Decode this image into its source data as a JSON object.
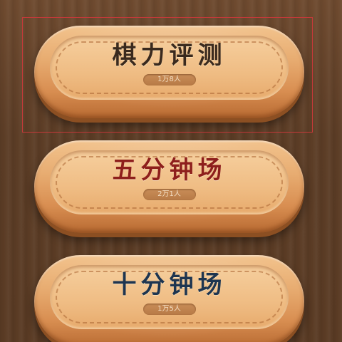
{
  "highlight": {
    "color": "#c6393a"
  },
  "modes": [
    {
      "title": "棋力评测",
      "badge": "1万8人",
      "title_color": "#3a2a1e"
    },
    {
      "title": "五分钟场",
      "badge": "2万1人",
      "title_color": "#8e1f1c"
    },
    {
      "title": "十分钟场",
      "badge": "1万5人",
      "title_color": "#1e3550"
    }
  ]
}
